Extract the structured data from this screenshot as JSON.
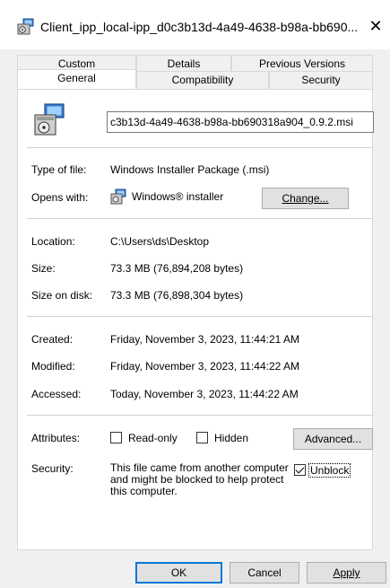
{
  "window": {
    "title": "Client_ipp_local-ipp_d0c3b13d-4a49-4638-b98a-bb690...",
    "close_symbol": "✕"
  },
  "tabs": {
    "top_row": [
      "Custom",
      "Details",
      "Previous Versions"
    ],
    "bottom_row": [
      "General",
      "Compatibility",
      "Security"
    ],
    "selected": "General"
  },
  "file": {
    "name": "c3b13d-4a49-4638-b98a-bb690318a904_0.9.2.msi",
    "icon": "msi-installer-icon"
  },
  "type_of_file": {
    "label": "Type of file:",
    "value": "Windows Installer Package (.msi)"
  },
  "opens_with": {
    "label": "Opens with:",
    "value": "Windows® installer",
    "icon": "windows-installer-icon",
    "change_button": "Change..."
  },
  "location": {
    "label": "Location:",
    "value": "C:\\Users\\ds\\Desktop"
  },
  "size": {
    "label": "Size:",
    "value": "73.3 MB (76,894,208 bytes)"
  },
  "size_on_disk": {
    "label": "Size on disk:",
    "value": "73.3 MB (76,898,304 bytes)"
  },
  "created": {
    "label": "Created:",
    "value": "Friday, November 3, 2023, 11:44:21 AM"
  },
  "modified": {
    "label": "Modified:",
    "value": "Friday, November 3, 2023, 11:44:22 AM"
  },
  "accessed": {
    "label": "Accessed:",
    "value": "Today, November 3, 2023, 11:44:22 AM"
  },
  "attributes": {
    "label": "Attributes:",
    "read_only": {
      "label": "Read-only",
      "checked": false
    },
    "hidden": {
      "label": "Hidden",
      "checked": false
    },
    "advanced_button": "Advanced..."
  },
  "security": {
    "label": "Security:",
    "text": "This file came from another computer and might be blocked to help protect this computer.",
    "unblock": {
      "label": "Unblock",
      "checked": true
    }
  },
  "footer": {
    "ok": "OK",
    "cancel": "Cancel",
    "apply": "Apply"
  },
  "colors": {
    "accent": "#0078d7",
    "panel_bg": "#ffffff",
    "window_bg": "#f0f0f0"
  }
}
